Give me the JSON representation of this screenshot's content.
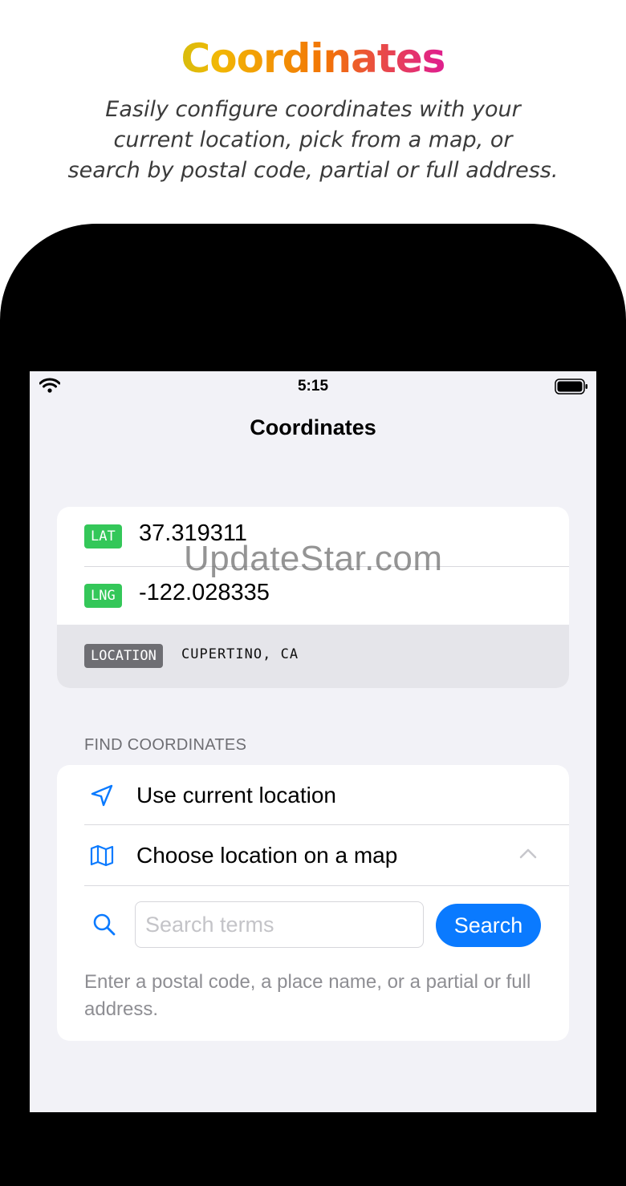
{
  "promo": {
    "title": "Coordinates",
    "subtitle": "Easily configure coordinates with your\ncurrent location, pick from a map, or\nsearch by postal code, partial or full address."
  },
  "status_bar": {
    "time": "5:15"
  },
  "nav": {
    "title": "Coordinates"
  },
  "coordinates": {
    "lat_tag": "LAT",
    "lat_value": "37.319311",
    "lng_tag": "LNG",
    "lng_value": "-122.028335",
    "location_tag": "LOCATION",
    "location_value": "CUPERTINO, CA"
  },
  "watermark": "UpdateStar.com",
  "find": {
    "header": "FIND COORDINATES",
    "current_location_label": "Use current location",
    "map_label": "Choose location on a map",
    "search_placeholder": "Search terms",
    "search_value": "",
    "search_button": "Search",
    "hint": "Enter a postal code, a place name, or a partial or full address."
  },
  "colors": {
    "accent": "#0a7aff",
    "tag_green": "#34c759",
    "tag_gray": "#6e6e73",
    "background": "#f2f2f7"
  },
  "icons": [
    "wifi-icon",
    "battery-icon",
    "location-arrow-icon",
    "map-icon",
    "chevron-up-icon",
    "search-icon"
  ]
}
